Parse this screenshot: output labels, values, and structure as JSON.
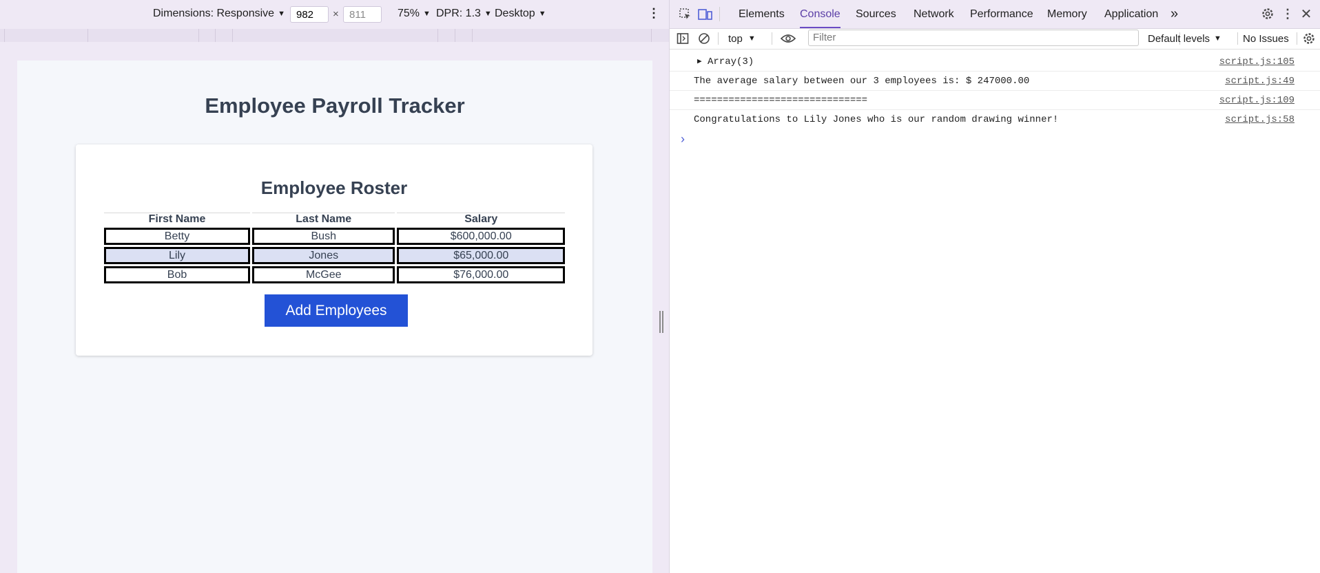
{
  "device_toolbar": {
    "dimensions_label": "Dimensions: Responsive",
    "width_value": "982",
    "times": "×",
    "height_value": "811",
    "zoom": "75%",
    "dpr": "DPR: 1.3",
    "device_mode": "Desktop",
    "more_icon": "kebab-icon"
  },
  "page": {
    "title": "Employee Payroll Tracker",
    "roster_title": "Employee Roster",
    "table": {
      "headers": [
        "First Name",
        "Last Name",
        "Salary"
      ],
      "rows": [
        [
          "Betty",
          "Bush",
          "$600,000.00"
        ],
        [
          "Lily",
          "Jones",
          "$65,000.00"
        ],
        [
          "Bob",
          "McGee",
          "$76,000.00"
        ]
      ]
    },
    "add_button": "Add Employees",
    "accent_color": "#2352d6"
  },
  "devtools": {
    "tabs": [
      "Elements",
      "Console",
      "Sources",
      "Network",
      "Performance",
      "Memory",
      "Application"
    ],
    "active_tab": "Console",
    "more_tabs": "»",
    "console_toolbar": {
      "context": "top",
      "filter_placeholder": "Filter",
      "levels": "Default levels",
      "issues": "No Issues"
    },
    "console_lines": [
      {
        "message": "Array(3)",
        "source": "script.js:105",
        "expandable": true
      },
      {
        "message": "The average salary between our 3 employees is: $ 247000.00",
        "source": "script.js:49"
      },
      {
        "message": "==============================",
        "source": "script.js:109"
      },
      {
        "message": "Congratulations to Lily Jones who is our random drawing winner!",
        "source": "script.js:58"
      }
    ],
    "prompt": "›"
  }
}
